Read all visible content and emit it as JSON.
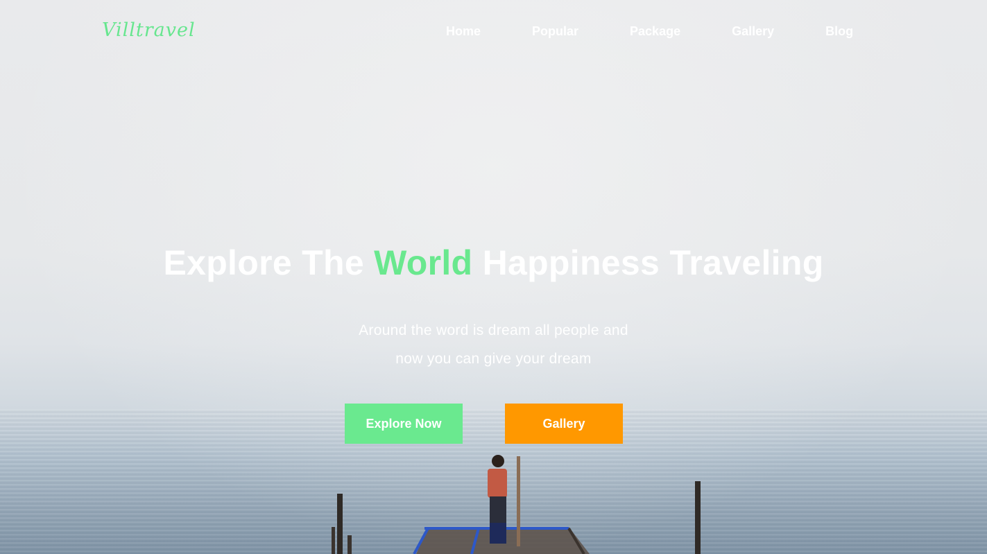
{
  "brand": {
    "logo_text": "Villtravel",
    "accent_color": "#66e68e"
  },
  "nav": {
    "items": [
      {
        "label": "Home"
      },
      {
        "label": "Popular"
      },
      {
        "label": "Package"
      },
      {
        "label": "Gallery"
      },
      {
        "label": "Blog"
      }
    ]
  },
  "hero": {
    "headline_prefix": "Explore The ",
    "headline_accent": "World",
    "headline_suffix": " Happiness Traveling",
    "subtitle_line1": "Around the word is dream all people and",
    "subtitle_line2": "now you can give your dream",
    "primary_button": "Explore Now",
    "secondary_button": "Gallery",
    "primary_color": "#6ae98f",
    "secondary_color": "#ff9800"
  }
}
